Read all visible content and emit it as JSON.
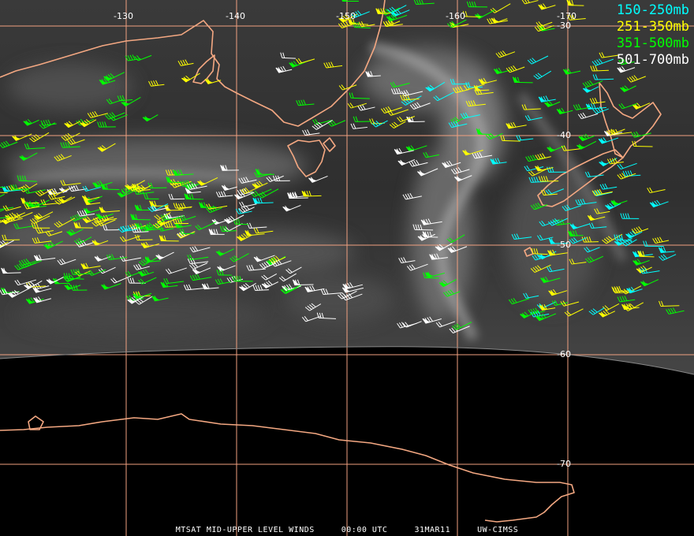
{
  "legend": [
    {
      "label": "150-250mb",
      "color": "#00ffff"
    },
    {
      "label": "251-350mb",
      "color": "#ffff00"
    },
    {
      "label": "351-500mb",
      "color": "#00ff00"
    },
    {
      "label": "501-700mb",
      "color": "#ffffff"
    }
  ],
  "lon_labels": [
    "-130",
    "-140",
    "-150",
    "-160",
    "-170"
  ],
  "lat_labels": [
    "-30",
    "-40",
    "-50",
    "-60",
    "-70"
  ],
  "footer": {
    "product": "MTSAT MID-UPPER LEVEL WINDS",
    "time": "00:00 UTC",
    "date": "31MAR11",
    "source": "UW-CIMSS"
  },
  "colors": {
    "grid": "#f0a080",
    "coast": "#f0a080",
    "imagery_dark": "#2b2b2b",
    "imagery_light": "#6a6a6a",
    "night": "#000000"
  }
}
